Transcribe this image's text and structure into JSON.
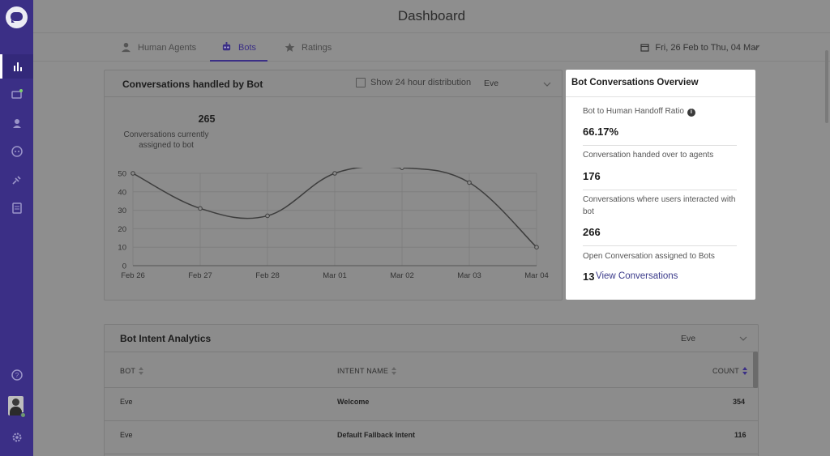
{
  "header": {
    "title": "Dashboard"
  },
  "tabs": [
    {
      "label": "Human Agents",
      "icon": "person-icon"
    },
    {
      "label": "Bots",
      "icon": "bot-icon"
    },
    {
      "label": "Ratings",
      "icon": "star-icon"
    }
  ],
  "date_range": {
    "label": "Fri, 26 Feb to Thu, 04 Mar"
  },
  "chart_card": {
    "title": "Conversations handled by Bot",
    "checkbox_label": "Show 24 hour distribution",
    "bot_select": "Eve",
    "kpi_value": "265",
    "kpi_label": "Conversations currently assigned to bot"
  },
  "chart_data": {
    "type": "line",
    "x": [
      "Feb 26",
      "Feb 27",
      "Feb 28",
      "Mar 01",
      "Mar 02",
      "Mar 03",
      "Mar 04"
    ],
    "series": [
      {
        "values": [
          50,
          31,
          27,
          50,
          53,
          45,
          10
        ]
      }
    ],
    "ylim": [
      0,
      50
    ],
    "yticks": [
      0,
      10,
      20,
      30,
      40,
      50
    ],
    "grid": true
  },
  "overview": {
    "title": "Bot Conversations Overview",
    "handoff_label": "Bot to Human Handoff Ratio",
    "handoff_value": "66.17%",
    "handed_label": "Conversation handed over to agents",
    "handed_value": "176",
    "interacted_label": "Conversations where users interacted with bot",
    "interacted_value": "266",
    "open_label": "Open Conversation assigned to Bots",
    "open_value": "13",
    "view_link": "View Conversations"
  },
  "intent": {
    "title": "Bot Intent Analytics",
    "bot_select": "Eve",
    "columns": [
      "BOT",
      "INTENT NAME",
      "COUNT"
    ],
    "rows": [
      {
        "bot": "Eve",
        "intent": "Welcome",
        "count": "354"
      },
      {
        "bot": "Eve",
        "intent": "Default Fallback Intent",
        "count": "116"
      }
    ]
  },
  "colors": {
    "sidebar": "#3b2f86",
    "accent": "#3b2f86",
    "overlay": "#8e8e8e"
  }
}
